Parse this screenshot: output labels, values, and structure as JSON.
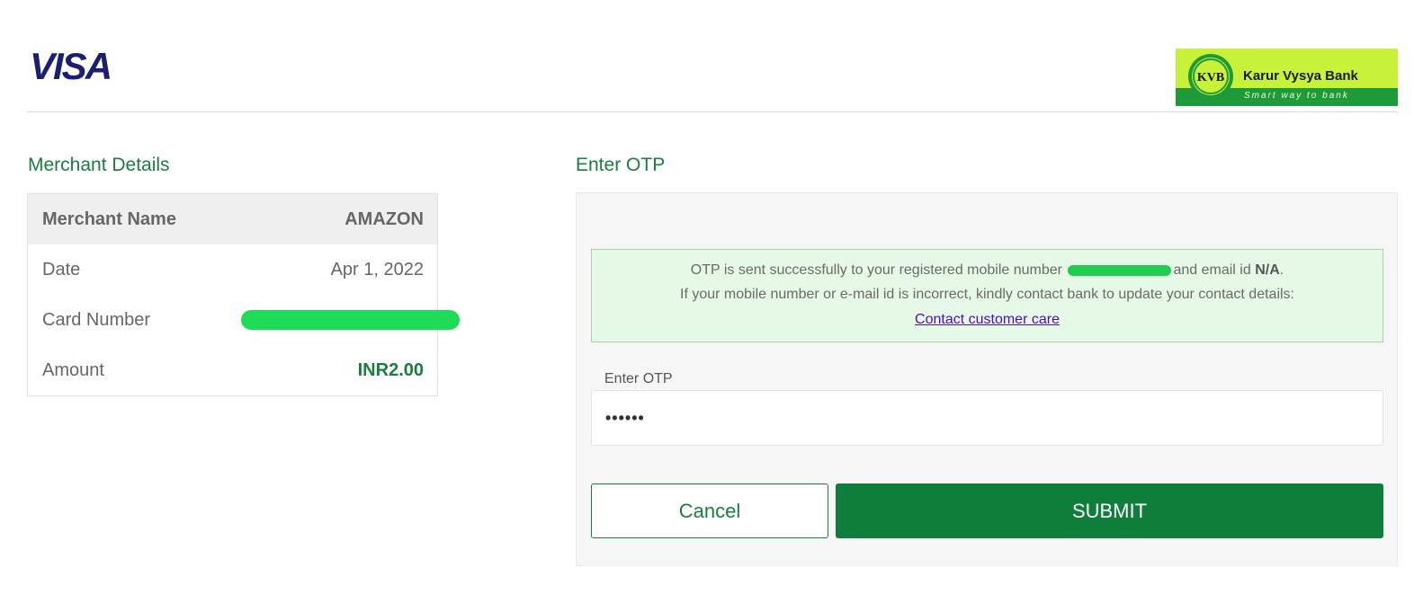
{
  "header": {
    "visa_logo_text": "VISA",
    "bank_logo": {
      "emblem_text": "KVB",
      "bank_name": "Karur Vysya Bank",
      "tagline": "Smart way to bank"
    }
  },
  "merchant": {
    "title": "Merchant Details",
    "rows": [
      {
        "label": "Merchant Name",
        "value": "AMAZON"
      },
      {
        "label": "Date",
        "value": "Apr 1, 2022"
      },
      {
        "label": "Card Number",
        "value": ""
      },
      {
        "label": "Amount",
        "value": "INR2.00"
      }
    ]
  },
  "otp": {
    "title": "Enter OTP",
    "info": {
      "line1_before": "OTP is sent successfully to your registered mobile number",
      "line1_middle": "and email id",
      "email_value": "N/A",
      "line1_end": ".",
      "line2": "If your mobile number or e-mail id is incorrect, kindly contact bank to update your contact details:",
      "link_text": "Contact customer care"
    },
    "field_label": "Enter OTP",
    "field_value": "••••••",
    "cancel_label": "Cancel",
    "submit_label": "SUBMIT"
  },
  "colors": {
    "accent_green": "#1b7d40",
    "button_green": "#0f7d3c",
    "visa_purple": "#1a1f71",
    "kvb_lime": "#c8f23a",
    "kvb_green": "#1f9a3a",
    "link_purple": "#4b0ccf",
    "info_bg": "#e6f9e6"
  }
}
